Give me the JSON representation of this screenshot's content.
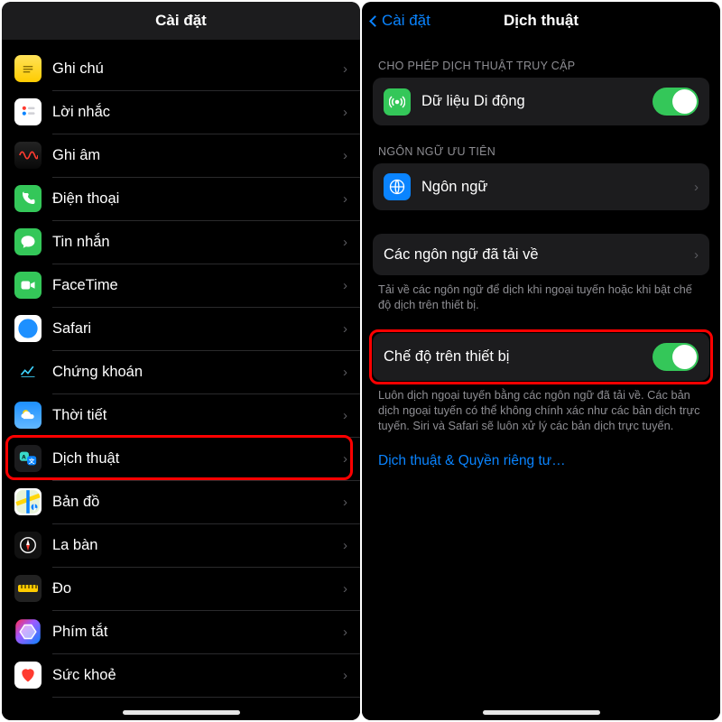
{
  "left": {
    "title": "Cài đặt",
    "items": [
      {
        "name": "notes",
        "label": "Ghi chú"
      },
      {
        "name": "reminders",
        "label": "Lời nhắc"
      },
      {
        "name": "voicememo",
        "label": "Ghi âm"
      },
      {
        "name": "phone",
        "label": "Điện thoại"
      },
      {
        "name": "messages",
        "label": "Tin nhắn"
      },
      {
        "name": "facetime",
        "label": "FaceTime"
      },
      {
        "name": "safari",
        "label": "Safari"
      },
      {
        "name": "stocks",
        "label": "Chứng khoán"
      },
      {
        "name": "weather",
        "label": "Thời tiết"
      },
      {
        "name": "translate",
        "label": "Dịch thuật",
        "highlight": true
      },
      {
        "name": "maps",
        "label": "Bản đồ"
      },
      {
        "name": "compass",
        "label": "La bàn"
      },
      {
        "name": "measure",
        "label": "Đo"
      },
      {
        "name": "shortcuts",
        "label": "Phím tắt"
      },
      {
        "name": "health",
        "label": "Sức khoẻ"
      }
    ]
  },
  "right": {
    "back_label": "Cài đặt",
    "title": "Dịch thuật",
    "section1_header": "CHO PHÉP DỊCH THUẬT TRUY CẬP",
    "cellular_label": "Dữ liệu Di động",
    "cellular_on": true,
    "section2_header": "NGÔN NGỮ ƯU TIÊN",
    "languages_label": "Ngôn ngữ",
    "downloaded_label": "Các ngôn ngữ đã tải về",
    "downloaded_footer": "Tải về các ngôn ngữ để dịch khi ngoại tuyến hoặc khi bật chế độ dịch trên thiết bị.",
    "ondevice_label": "Chế độ trên thiết bị",
    "ondevice_on": true,
    "ondevice_highlight": true,
    "ondevice_footer": "Luôn dịch ngoại tuyến bằng các ngôn ngữ đã tải về. Các bản dịch ngoại tuyến có thể không chính xác như các bản dịch trực tuyến. Siri và Safari sẽ luôn xử lý các bản dịch trực tuyến.",
    "privacy_link": "Dịch thuật & Quyền riêng tư…"
  }
}
